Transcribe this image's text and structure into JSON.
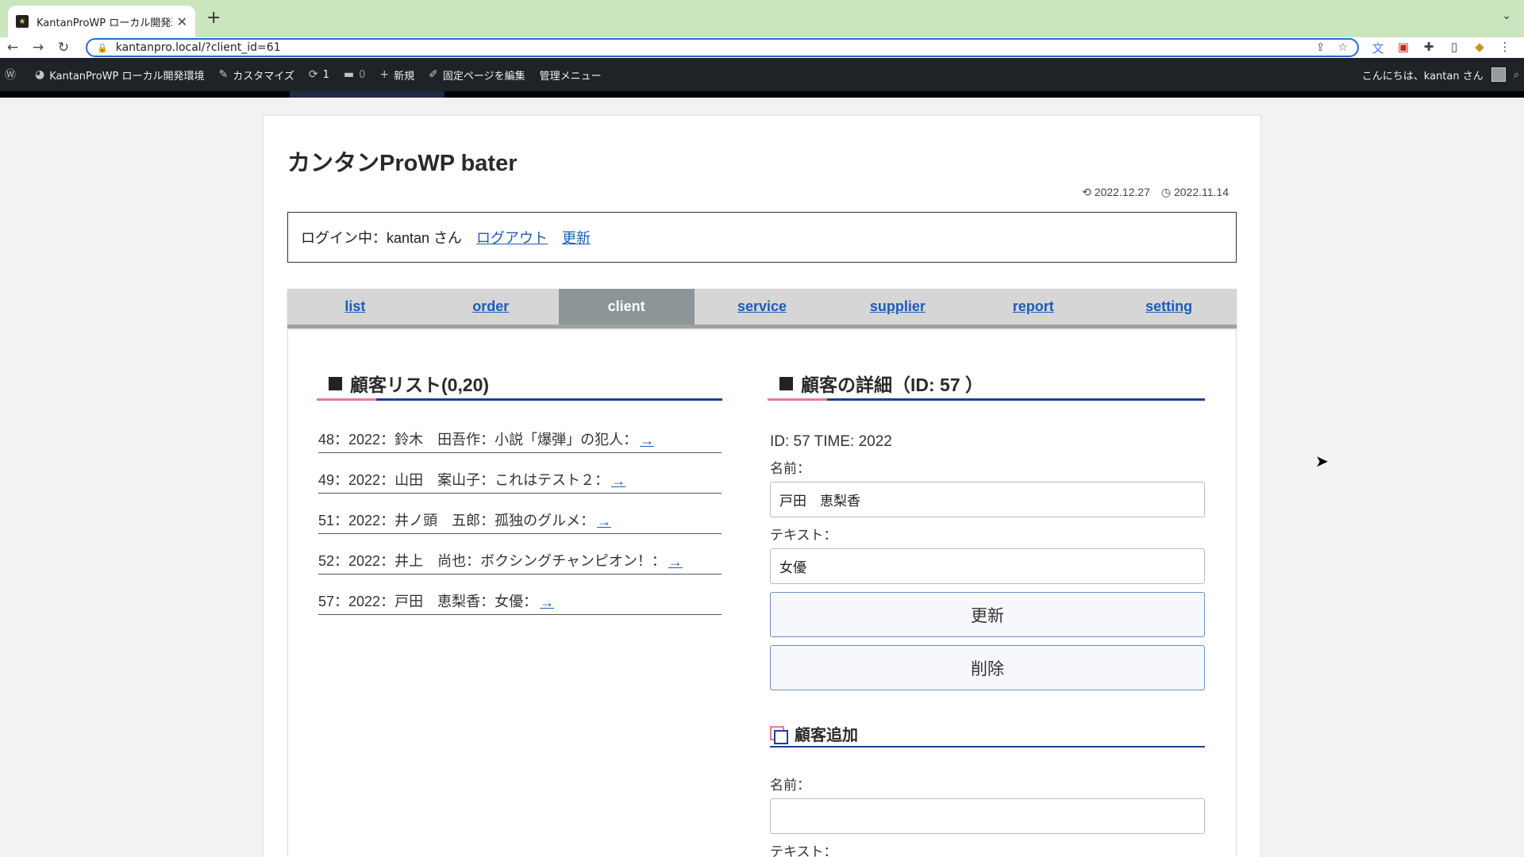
{
  "browser": {
    "tab_title": "KantanProWP ローカル開発環境",
    "url": "kantanpro.local/?client_id=61"
  },
  "wpbar": {
    "site_name": "KantanProWP ローカル開発環境",
    "customize": "カスタマイズ",
    "updates": "1",
    "comments": "0",
    "new": "新規",
    "edit_page": "固定ページを編集",
    "admin_menu": "管理メニュー",
    "greeting": "こんにちは、kantan さん"
  },
  "page": {
    "title": "カンタンProWP bater",
    "modified_date": "2022.12.27",
    "published_date": "2022.11.14",
    "login_text": "ログイン中：kantan さん",
    "logout_label": "ログアウト",
    "refresh_label": "更新"
  },
  "tabs": [
    {
      "label": "list",
      "active": false
    },
    {
      "label": "order",
      "active": false
    },
    {
      "label": "client",
      "active": true
    },
    {
      "label": "service",
      "active": false
    },
    {
      "label": "supplier",
      "active": false
    },
    {
      "label": "report",
      "active": false
    },
    {
      "label": "setting",
      "active": false
    }
  ],
  "client_list": {
    "heading": "顧客リスト(0,20)",
    "items": [
      {
        "text": "48：2022：鈴木　田吾作：小説「爆弾」の犯人：",
        "link": "→"
      },
      {
        "text": "49：2022：山田　案山子：これはテスト２：",
        "link": "→"
      },
      {
        "text": "51：2022：井ノ頭　五郎：孤独のグルメ：",
        "link": "→"
      },
      {
        "text": "52：2022：井上　尚也：ボクシングチャンピオン！：",
        "link": "→"
      },
      {
        "text": "57：2022：戸田　恵梨香：女優：",
        "link": "→"
      }
    ]
  },
  "client_detail": {
    "heading": "顧客の詳細（ID: 57 ）",
    "id_line": "ID: 57 TIME: 2022",
    "name_label": "名前：",
    "name_value": "戸田　恵梨香",
    "text_label": "テキスト：",
    "text_value": "女優",
    "update_button": "更新",
    "delete_button": "削除"
  },
  "client_add": {
    "heading": "顧客追加",
    "name_label": "名前：",
    "name_value": "",
    "text_label": "テキスト："
  }
}
